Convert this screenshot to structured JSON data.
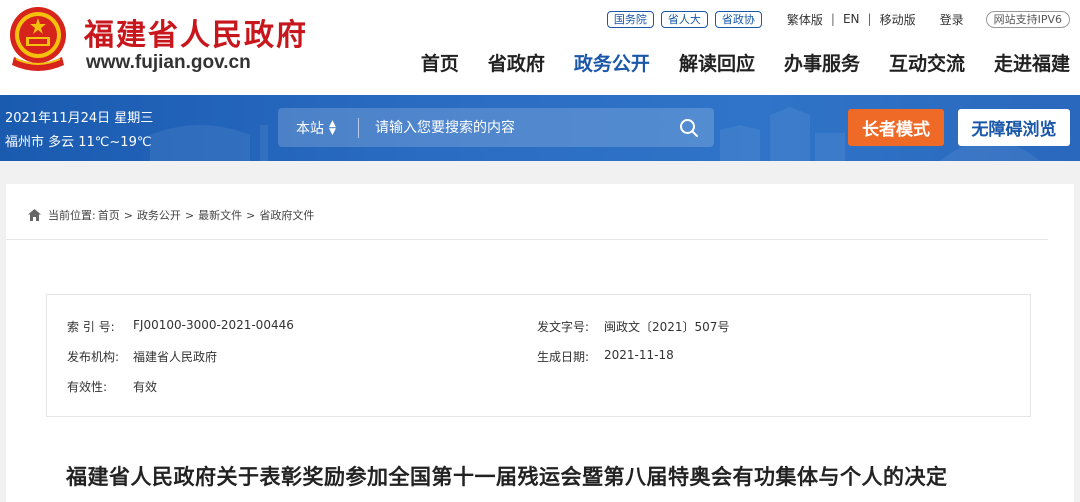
{
  "header": {
    "site_name": "福建省人民政府",
    "site_url": "www.fujian.gov.cn",
    "top_pills": [
      "国务院",
      "省人大",
      "省政协"
    ],
    "top_links": [
      "繁体版",
      "EN",
      "移动版"
    ],
    "login": "登录",
    "ipv6": "网站支持IPV6",
    "nav": [
      {
        "label": "首页"
      },
      {
        "label": "省政府"
      },
      {
        "label": "政务公开"
      },
      {
        "label": "解读回应"
      },
      {
        "label": "办事服务"
      },
      {
        "label": "互动交流"
      },
      {
        "label": "走进福建"
      }
    ],
    "nav_active_index": 2,
    "colors": {
      "brand_red": "#c8161d",
      "brand_blue": "#1a57a8",
      "accent_orange": "#ee6a26"
    }
  },
  "bar": {
    "date": "2021年11月24日 星期三",
    "weather": "福州市 多云 11℃~19℃",
    "search_scope": "本站",
    "search_placeholder": "请输入您要搜索的内容",
    "search_icon": "search-icon",
    "elder_mode": "长者模式",
    "accessible": "无障碍浏览"
  },
  "breadcrumb": {
    "prefix": "当前位置:",
    "items": [
      "首页",
      "政务公开",
      "最新文件",
      "省政府文件"
    ]
  },
  "meta": {
    "index_label": "索 引 号:",
    "index_value": "FJ00100-3000-2021-00446",
    "docno_label": "发文字号:",
    "docno_value": "闽政文〔2021〕507号",
    "org_label": "发布机构:",
    "org_value": "福建省人民政府",
    "date_label": "生成日期:",
    "date_value": "2021-11-18",
    "valid_label": "有效性:",
    "valid_value": "有效"
  },
  "document": {
    "title": "福建省人民政府关于表彰奖励参加全国第十一届残运会暨第八届特奥会有功集体与个人的决定"
  }
}
